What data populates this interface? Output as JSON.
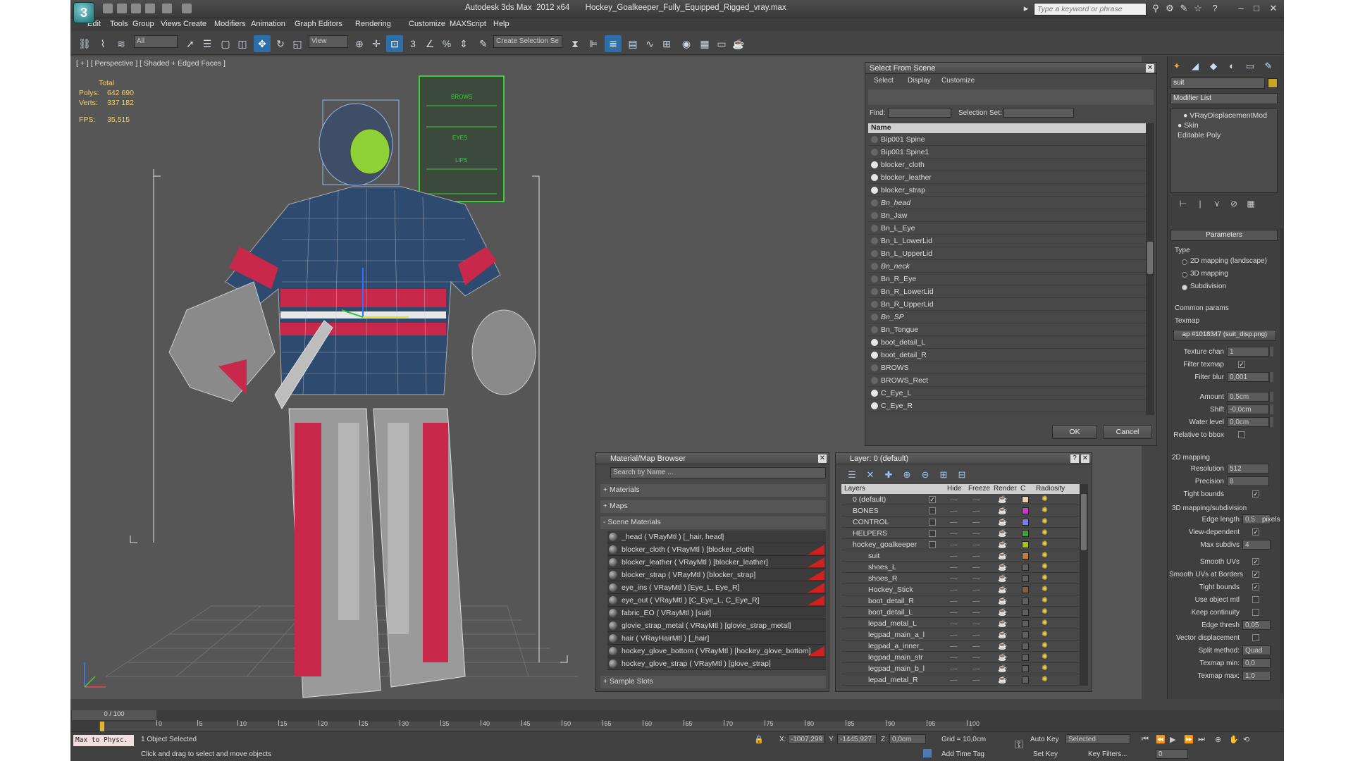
{
  "window": {
    "title": "Autodesk 3ds Max  2012 x64       Hockey_Goalkeeper_Fully_Equipped_Rigged_vray.max",
    "search_placeholder": "Type a keyword or phrase"
  },
  "menu": [
    "Edit",
    "Tools",
    "Group",
    "Views",
    "Create",
    "Modifiers",
    "Animation",
    "Graph Editors",
    "Rendering",
    "Customize",
    "MAXScript",
    "Help"
  ],
  "toolbar": {
    "filter_value": "All",
    "ref_coord_value": "View",
    "selection_set_placeholder": "Create Selection Se"
  },
  "viewport": {
    "label": "[ + ] [ Perspective ] [ Shaded + Edged Faces ]",
    "stats_header": "Total",
    "polys_label": "Polys:",
    "polys_value": "642 690",
    "verts_label": "Verts:",
    "verts_value": "337 182",
    "fps_label": "FPS:",
    "fps_value": "35,515",
    "face_chart": {
      "brows": "BROWS",
      "eyes": "EYES",
      "lips": "LIPS"
    }
  },
  "select_from_scene": {
    "title": "Select From Scene",
    "menu": [
      "Select",
      "Display",
      "Customize"
    ],
    "find_label": "Find:",
    "selection_set_label": "Selection Set:",
    "column_name": "Name",
    "items": [
      "Bip001 Spine",
      "Bip001 Spine1",
      "blocker_cloth",
      "blocker_leather",
      "blocker_strap",
      "Bn_head",
      "Bn_Jaw",
      "Bn_L_Eye",
      "Bn_L_LowerLid",
      "Bn_L_UpperLid",
      "Bn_neck",
      "Bn_R_Eye",
      "Bn_R_LowerLid",
      "Bn_R_UpperLid",
      "Bn_SP",
      "Bn_Tongue",
      "boot_detail_L",
      "boot_detail_R",
      "BROWS",
      "BROWS_Rect",
      "C_Eye_L",
      "C_Eye_R"
    ],
    "ok_label": "OK",
    "cancel_label": "Cancel"
  },
  "material_browser": {
    "title": "Material/Map Browser",
    "search_placeholder": "Search by Name ...",
    "groups": {
      "materials": "+ Materials",
      "maps": "+ Maps",
      "scene_materials": "- Scene Materials",
      "sample_slots": "+ Sample Slots"
    },
    "items": [
      "_head  ( VRayMtl )  [_hair, head]",
      "blocker_cloth  ( VRayMtl )  [blocker_cloth]",
      "blocker_leather  ( VRayMtl )  [blocker_leather]",
      "blocker_strap  ( VRayMtl )  [blocker_strap]",
      "eye_ins  ( VRayMtl )  [Eye_L, Eye_R]",
      "eye_out  ( VRayMtl )  [C_Eye_L, C_Eye_R]",
      "fabric_EO  ( VRayMtl )  [suit]",
      "glovie_strap_metal  ( VRayMtl )  [glovie_strap_metal]",
      "hair  ( VRayHairMtl )  [_hair]",
      "hockey_glove_bottom  ( VRayMtl )  [hockey_glove_bottom]",
      "hockey_glove_strap  ( VRayMtl )  [glove_strap]"
    ]
  },
  "layer_manager": {
    "title": "Layer: 0 (default)",
    "help": "?",
    "columns": [
      "Layers",
      "Hide",
      "Freeze",
      "Render",
      "C",
      "Radiosity"
    ],
    "rows": [
      "0 (default)",
      "BONES",
      "CONTROL",
      "HELPERS",
      "hockey_goalkeeper",
      "suit",
      "shoes_L",
      "shoes_R",
      "Hockey_Stick",
      "boot_detail_R",
      "boot_detail_L",
      "lepad_metal_L",
      "legpad_main_a_l",
      "legpad_a_inner_",
      "legpad_main_str",
      "legpad_main_b_l",
      "lepad_metal_R"
    ]
  },
  "command_panel": {
    "object_name": "suit",
    "modifier_list": "Modifier List",
    "stack": [
      "VRayDisplacementMod",
      "Skin",
      "Editable Poly"
    ],
    "rollout_title": "Parameters",
    "type_label": "Type",
    "type_options": [
      "2D mapping (landscape)",
      "3D mapping",
      "Subdivision"
    ],
    "common_params": "Common params",
    "texmap_label": "Texmap",
    "texmap_value": "ap #1018347 (suit_disp.png)",
    "texture_chan_label": "Texture chan",
    "texture_chan_value": "1",
    "filter_texmap_label": "Filter texmap",
    "filter_blur_label": "Filter blur",
    "filter_blur_value": "0,001",
    "amount_label": "Amount",
    "amount_value": "0,5cm",
    "shift_label": "Shift",
    "shift_value": "-0,0cm",
    "water_level_label": "Water level",
    "water_level_value": "0,0cm",
    "relative_bbox_label": "Relative to bbox",
    "mapping_2d": "2D mapping",
    "resolution_label": "Resolution",
    "resolution_value": "512",
    "precision_label": "Precision",
    "precision_value": "8",
    "tight_bounds_label": "Tight bounds",
    "mapping_3d": "3D mapping/subdivision",
    "edge_length_label": "Edge length",
    "edge_length_value": "0,5",
    "pixels_label": "pixels",
    "view_dependent_label": "View-dependent",
    "max_subdivs_label": "Max subdivs",
    "max_subdivs_value": "4",
    "smooth_uvs_label": "Smooth UVs",
    "smooth_uvs_borders_label": "Smooth UVs at Borders",
    "tight_bounds2_label": "Tight bounds",
    "use_object_mtl_label": "Use object mtl",
    "keep_continuity_label": "Keep continuity",
    "edge_thresh_label": "Edge thresh",
    "edge_thresh_value": "0,05",
    "vector_disp_label": "Vector displacement",
    "split_method_label": "Split method:",
    "split_method_value": "Quad",
    "texmap_min_label": "Texmap min:",
    "texmap_min_value": "0,0",
    "texmap_max_label": "Texmap max:",
    "texmap_max_value": "1,0"
  },
  "timeline": {
    "frame_display": "0 / 100",
    "ticks": [
      "0",
      "5",
      "10",
      "15",
      "20",
      "25",
      "30",
      "35",
      "40",
      "45",
      "50",
      "55",
      "60",
      "65",
      "70",
      "75",
      "80",
      "85",
      "90",
      "95",
      "100"
    ]
  },
  "status": {
    "maxscript_label": "Max to Physc.",
    "selection_text": "1 Object Selected",
    "prompt_text": "Click and drag to select and move objects",
    "x_label": "X:",
    "x_value": "-1007,299",
    "y_label": "Y:",
    "y_value": "-1445,927",
    "z_label": "Z:",
    "z_value": "0,0cm",
    "grid_text": "Grid = 10,0cm",
    "add_time_tag": "Add Time Tag",
    "auto_key": "Auto Key",
    "set_key": "Set Key",
    "selected_value": "Selected",
    "key_filters": "Key Filters...",
    "frame_value": "0"
  }
}
